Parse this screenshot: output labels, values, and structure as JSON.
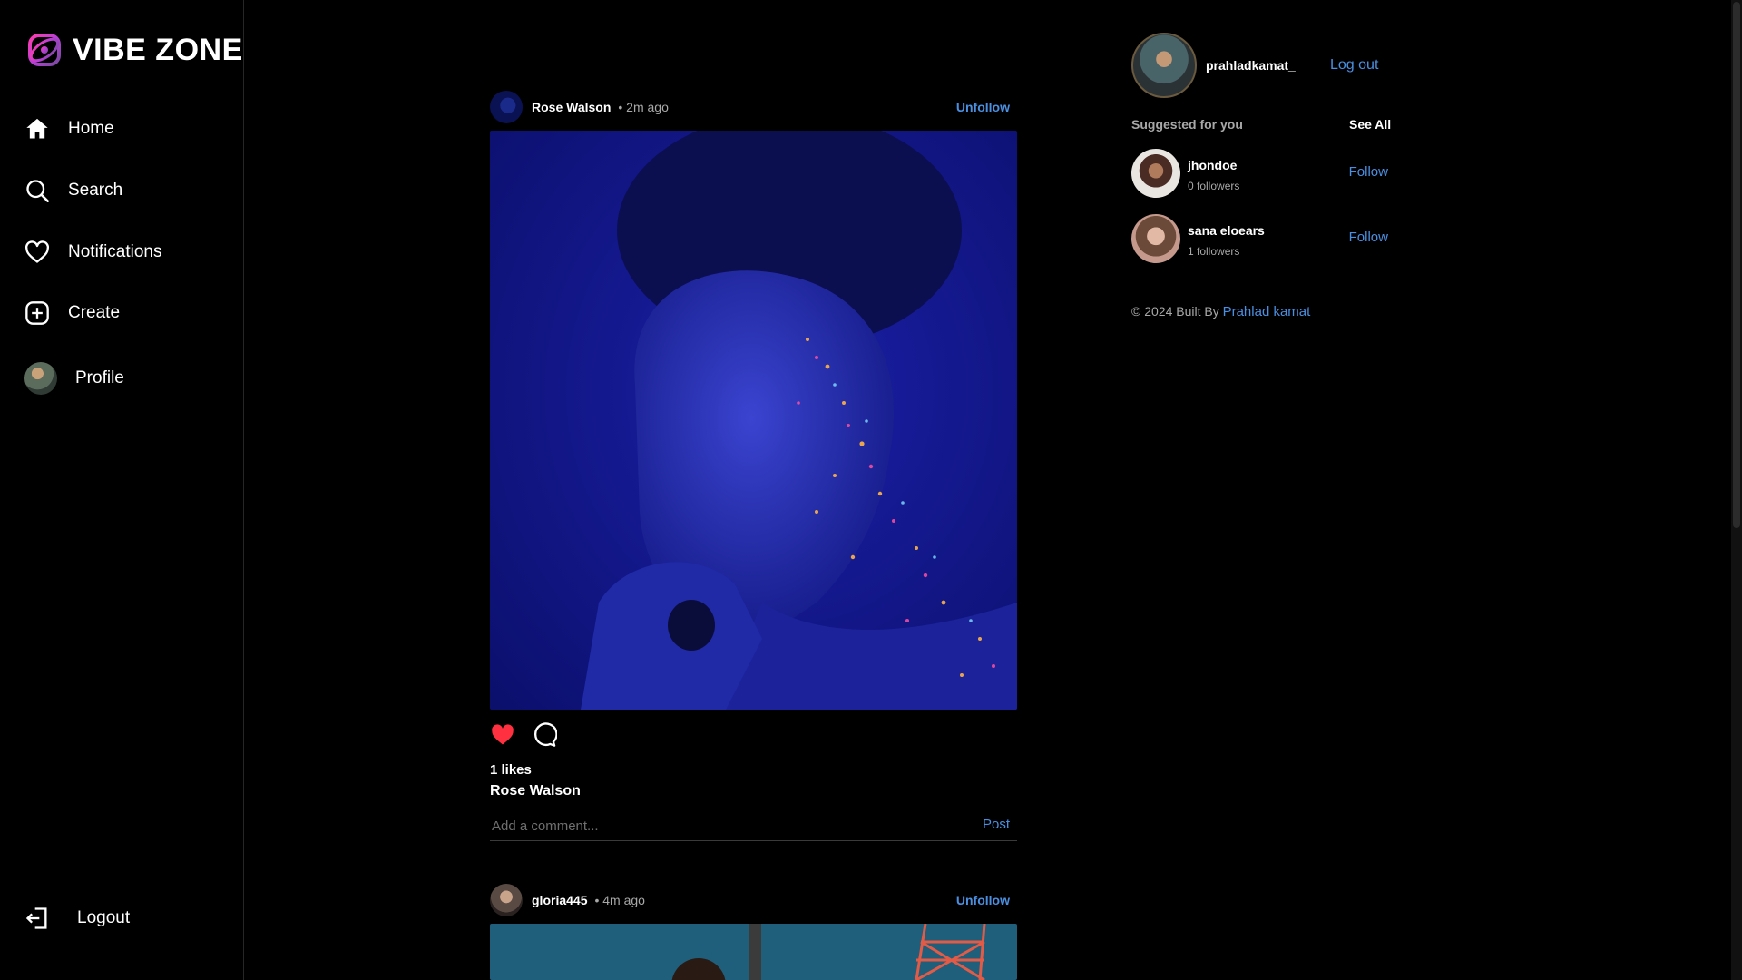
{
  "app": {
    "name": "VIBE ZONE"
  },
  "sidebar": {
    "items": [
      {
        "label": "Home",
        "icon": "home-icon"
      },
      {
        "label": "Search",
        "icon": "search-icon"
      },
      {
        "label": "Notifications",
        "icon": "heart-icon"
      },
      {
        "label": "Create",
        "icon": "plus-square-icon"
      },
      {
        "label": "Profile",
        "icon": "avatar"
      }
    ],
    "logout": {
      "label": "Logout",
      "icon": "logout-icon"
    }
  },
  "feed": {
    "posts": [
      {
        "user": "Rose Walson",
        "time": "• 2m ago",
        "follow_label": "Unfollow",
        "likes": "1 likes",
        "caption_user": "Rose Walson",
        "comment_placeholder": "Add a comment...",
        "post_label": "Post",
        "liked": true
      },
      {
        "user": "gloria445",
        "time": "• 4m ago",
        "follow_label": "Unfollow"
      }
    ]
  },
  "right_panel": {
    "current_user": "prahladkamat_",
    "logout_label": "Log out",
    "suggested_title": "Suggested for you",
    "see_all": "See All",
    "suggestions": [
      {
        "name": "jhondoe",
        "followers": "0 followers",
        "follow_label": "Follow"
      },
      {
        "name": "sana eloears",
        "followers": "1 followers",
        "follow_label": "Follow"
      }
    ],
    "footer_text": "© 2024 Built By",
    "footer_link": "Prahlad kamat"
  },
  "colors": {
    "accent": "#4a90e2",
    "like": "#ff3040",
    "background": "#000000",
    "logo_gradient": [
      "#ff3cac",
      "#784ba0",
      "#2b86c5"
    ]
  }
}
